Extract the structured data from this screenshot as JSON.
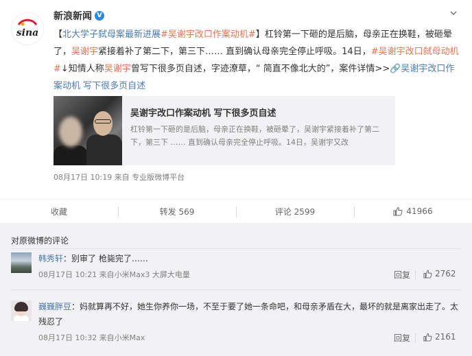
{
  "post": {
    "author": "新浪新闻",
    "logo_text": "sina",
    "text_parts": {
      "open": "【",
      "tag1": "北大学子弑母案最新进展",
      "tag2": "#吴谢宇改口作案动机#",
      "p1": "】杠铃第一下砸的是后脑，母亲正在换鞋，被砸晕了，",
      "name1": "吴谢宇",
      "p2": "紧接着补了第二下，第三下…… 直到确认母亲完全停止呼吸。14日，",
      "tag3": "#吴谢宇改口弑母动机#",
      "p3": "↓知情人称",
      "name2": "吴谢宇",
      "p4": "曾写下很多页自述，字迹潦草，“ 简直不像北大的”，案件详情>>",
      "link": "吴谢宇改口作案动机 写下很多页自述"
    },
    "card": {
      "title": "吴谢宇改口作案动机 写下很多页自述",
      "desc": "杠铃第一下砸的是后脑，母亲正在换鞋，被砸晕了，吴谢宇紧接着补了第二下，第三下 …… 直到确认母亲完全停止呼吸。14日，吴谢宇又改"
    },
    "meta": "08月17日 10:19  来自 专业版微博平台"
  },
  "actions": {
    "favorite": "收藏",
    "repost": "转发 569",
    "comment": "评论 2599",
    "like": "41966"
  },
  "comments": {
    "title": "对原微博的评论",
    "items": [
      {
        "user": "韩秀轩",
        "text": "：别审了 枪毙完了……",
        "meta": "08月17日 10:21  来自小米Max3 大屏大电量",
        "reply": "回复",
        "likes": "2762"
      },
      {
        "user": "巍巍胖豆",
        "text": "：妈就算再不好，她生你养你一场，不至于要了她一条命吧，和母亲矛盾在大，最坏的就是离家出走了。太残忍了",
        "meta": "08月17日 10:32  来自小米Max",
        "reply": "回复",
        "likes": "2161"
      }
    ]
  },
  "colors": {
    "accent": "#eb7350",
    "link": "#4b7bb0",
    "badge": "#2a8bd8",
    "background": "#f2f2f5"
  }
}
